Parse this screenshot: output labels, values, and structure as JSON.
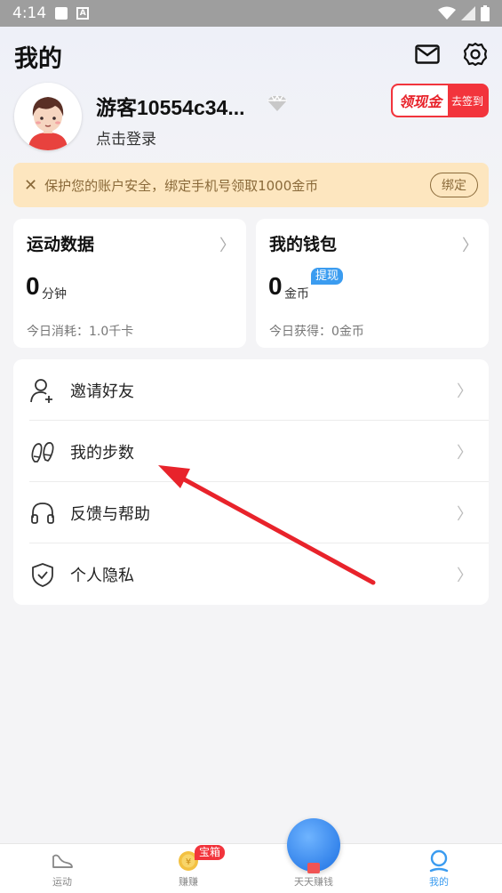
{
  "status_bar": {
    "time": "4:14"
  },
  "header": {
    "title": "我的"
  },
  "profile": {
    "username": "游客10554c34...",
    "login_hint": "点击登录"
  },
  "checkin": {
    "main": "领现金",
    "sub": "去签到"
  },
  "notice": {
    "text": "保护您的账户安全，绑定手机号领取1000金币",
    "button": "绑定"
  },
  "cards": {
    "sports": {
      "title": "运动数据",
      "value": "0",
      "unit": "分钟",
      "footer": "今日消耗：1.0千卡"
    },
    "wallet": {
      "title": "我的钱包",
      "value": "0",
      "unit": "金币",
      "tag": "提现",
      "footer": "今日获得：0金币"
    }
  },
  "menu": {
    "items": [
      {
        "label": "邀请好友",
        "icon": "user-plus-icon"
      },
      {
        "label": "我的步数",
        "icon": "footprints-icon"
      },
      {
        "label": "反馈与帮助",
        "icon": "headphones-icon"
      },
      {
        "label": "个人隐私",
        "icon": "shield-check-icon"
      }
    ]
  },
  "tabbar": {
    "tabs": [
      {
        "label": "运动",
        "icon": "sneaker-icon"
      },
      {
        "label": "赚赚",
        "icon": "coin-icon",
        "badge": "宝箱"
      },
      {
        "label": "天天赚钱",
        "icon": "gift-icon"
      },
      {
        "label": "我的",
        "icon": "person-icon"
      }
    ],
    "active_index": 3
  },
  "colors": {
    "accent": "#3b9cf0",
    "annotation_arrow": "#e8232b",
    "notice_bg": "#fde6bf",
    "checkin_red": "#f2343c"
  }
}
